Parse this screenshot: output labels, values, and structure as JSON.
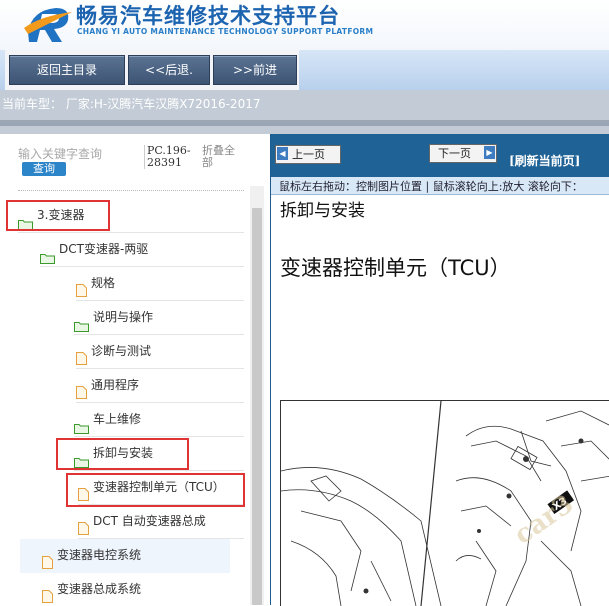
{
  "header": {
    "title": "畅易汽车维修技术支持平台",
    "subtitle": "CHANG YI AUTO MAINTENANCE TECHNOLOGY SUPPORT PLATFORM"
  },
  "toolbar": {
    "home_label": "返回主目录",
    "back_label": "<<后退.",
    "forward_label": ">>前进"
  },
  "car_bar": {
    "text": "当前车型：  厂家:H-汉腾汽车汉腾X72016-2017"
  },
  "search": {
    "placeholder": "输入关键字查询",
    "button_label": "查询",
    "pc_code": "PC.196-28391",
    "collapse_all": "折叠全部"
  },
  "tree": {
    "items": [
      {
        "label": "3.变速器",
        "icon": "folder-icon"
      },
      {
        "label": "DCT变速器-两驱",
        "icon": "folder-icon"
      },
      {
        "label": "规格",
        "icon": "document-icon"
      },
      {
        "label": "说明与操作",
        "icon": "folder-icon"
      },
      {
        "label": "诊断与测试",
        "icon": "document-icon"
      },
      {
        "label": "通用程序",
        "icon": "document-icon"
      },
      {
        "label": "车上维修",
        "icon": "folder-icon"
      },
      {
        "label": "拆卸与安装",
        "icon": "folder-icon"
      },
      {
        "label": "变速器控制单元（TCU）",
        "icon": "document-icon"
      },
      {
        "label": "DCT 自动变速器总成",
        "icon": "document-icon"
      },
      {
        "label": "变速器电控系统",
        "icon": "document-icon"
      },
      {
        "label": "变速器总成系统",
        "icon": "document-icon"
      }
    ]
  },
  "content": {
    "prev_label": "上一页",
    "next_label": "下一页",
    "refresh_label": "[刷新当前页]",
    "hint": "鼠标左右拖动：控制图片位置 | 鼠标滚轮向上:放大  滚轮向下：",
    "heading": "拆卸与安装",
    "subheading": "变速器控制单元（TCU）",
    "diagram_label": "X3",
    "watermark": "car3"
  },
  "colors": {
    "brand_blue": "#1c63b0",
    "toolbar_button": "#4a6285",
    "content_toolbar": "#1f6296",
    "highlight_red": "#e03434",
    "folder_green": "#3a9a2c",
    "doc_orange": "#e5a040"
  }
}
